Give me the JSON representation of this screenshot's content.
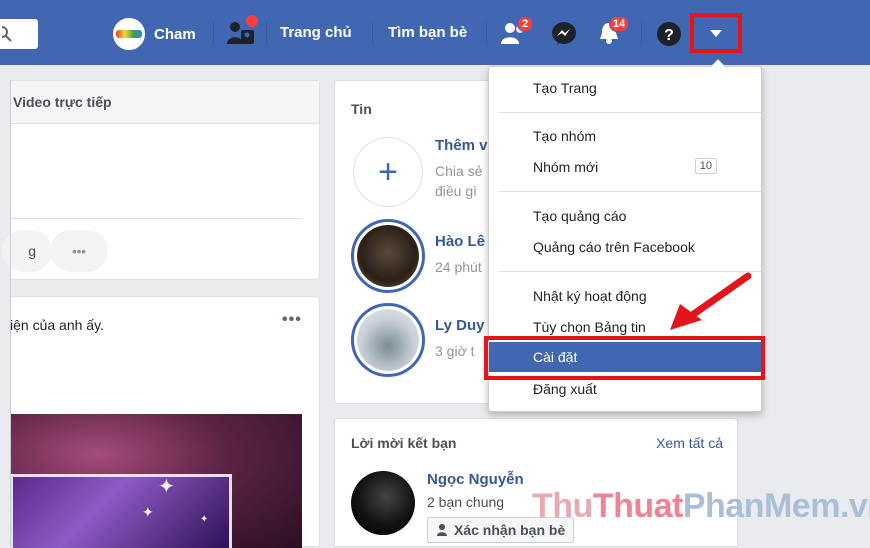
{
  "topbar": {
    "profile_name": "Cham",
    "nav_home": "Trang chủ",
    "nav_find_friends": "Tìm bạn bè",
    "friend_requests_count": "2",
    "notifications_count": "14",
    "brand_color": "#4267b2"
  },
  "composer": {
    "live_video_label": "Video trực tiếp",
    "chip_partial": "g",
    "more_label": "•••"
  },
  "post": {
    "text": "iện của anh ấy.",
    "more_label": "•••"
  },
  "stories": {
    "title": "Tin",
    "items": [
      {
        "name": "Thêm v",
        "sub_line1": "Chia sẻ",
        "sub_line2": "điều gì"
      },
      {
        "name": "Hào Lê",
        "sub_line1": "24 phút"
      },
      {
        "name": "Ly Duy",
        "sub_line1": "3 giờ t"
      }
    ]
  },
  "friend_requests": {
    "title": "Lời mời kết bạn",
    "see_all": "Xem tất cả",
    "request": {
      "name": "Ngọc Nguyễn",
      "mutual": "2 bạn chung",
      "confirm": "Xác nhận bạn bè"
    }
  },
  "dropdown": {
    "items": [
      {
        "label": "Tạo Trang"
      },
      {
        "label": "Tạo nhóm"
      },
      {
        "label": "Nhóm mới",
        "count": "10"
      },
      {
        "label": "Tạo quảng cáo"
      },
      {
        "label": "Quảng cáo trên Facebook"
      },
      {
        "label": "Nhật ký hoạt động"
      },
      {
        "label": "Tùy chọn Bảng tin"
      },
      {
        "label": "Cài đặt"
      },
      {
        "label": "Đăng xuất"
      }
    ],
    "highlight_color": "#e3141c"
  },
  "watermark": {
    "part1": "Thu",
    "part2": "Thuat",
    "part3": "PhanMem",
    "part4": ".vn"
  }
}
